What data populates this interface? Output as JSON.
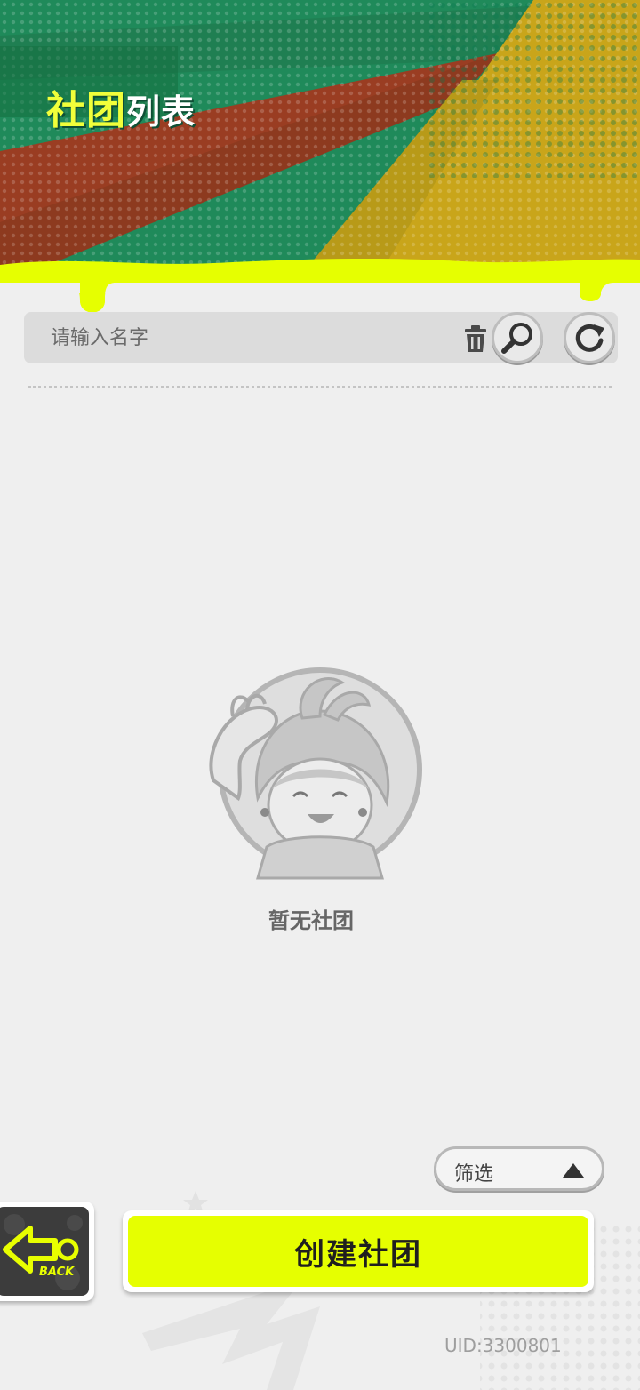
{
  "header": {
    "title_part1": "社团",
    "title_part2": "列表"
  },
  "search": {
    "placeholder": "请输入名字",
    "value": ""
  },
  "empty_state": {
    "message": "暂无社团"
  },
  "filter": {
    "label": "筛选"
  },
  "buttons": {
    "back_label": "BACK",
    "create_label": "创建社团"
  },
  "footer": {
    "uid": "UID:3300801"
  },
  "colors": {
    "accent_yellow": "#e6ff00",
    "banner_green": "#1f8a5a",
    "banner_red": "#9a3d22",
    "banner_gold": "#c9a51a"
  },
  "icons": [
    "trash-icon",
    "magnifier-icon",
    "refresh-icon",
    "chevron-up-icon",
    "back-arrow-icon"
  ]
}
